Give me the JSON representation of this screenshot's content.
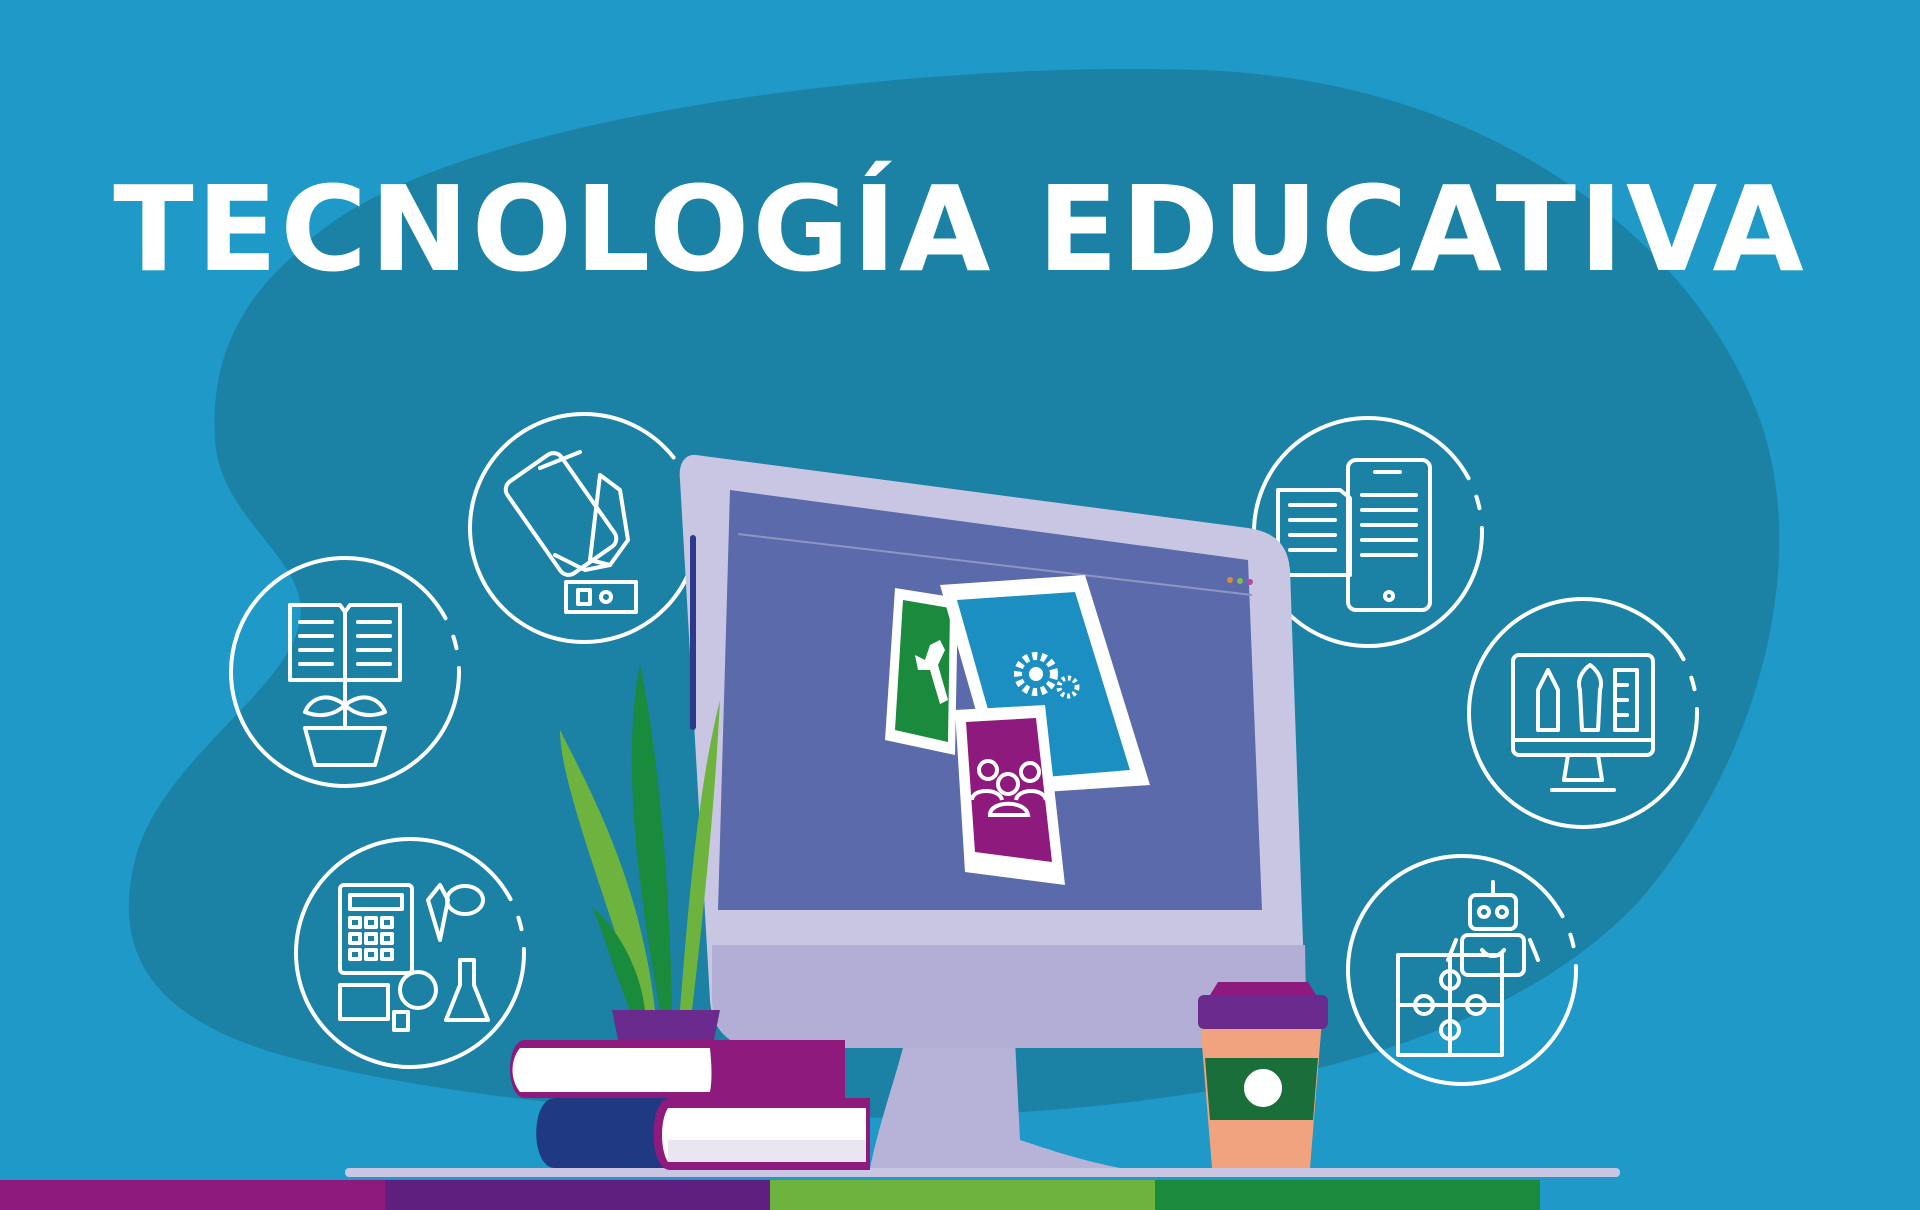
{
  "title": "TECNOLOGÍA EDUCATIVA",
  "colors": {
    "background": "#1f99c8",
    "blob": "#1b82a5",
    "white": "#ffffff",
    "monitor_frame": "#c9c6e3",
    "monitor_screen": "#5b6aaa",
    "card_green": "#1a8a3c",
    "card_blue": "#1b8ec2",
    "card_purple": "#8e1a7d",
    "book_purple": "#8e1a7d",
    "book_navy": "#1f3a82",
    "cup_lid": "#6b2a8e",
    "cup_body": "#f1a27e",
    "cup_band": "#1a6e3a",
    "plant": "#6fb33f",
    "stripe_1": "#8e1a7d",
    "stripe_2": "#5e1f7e",
    "stripe_3": "#6fb33f",
    "stripe_4": "#1a8a3c"
  },
  "icons": {
    "left": [
      "hand-phone-money-icon",
      "book-plant-icon",
      "calculator-science-icon"
    ],
    "right": [
      "ebook-phone-icon",
      "monitor-pencil-brush-icon",
      "robot-puzzle-icon"
    ],
    "screen": [
      "wrench-card-icon",
      "gears-card-icon",
      "team-card-icon"
    ],
    "desk": [
      "books-stack-icon",
      "plant-icon",
      "coffee-cup-icon"
    ]
  }
}
